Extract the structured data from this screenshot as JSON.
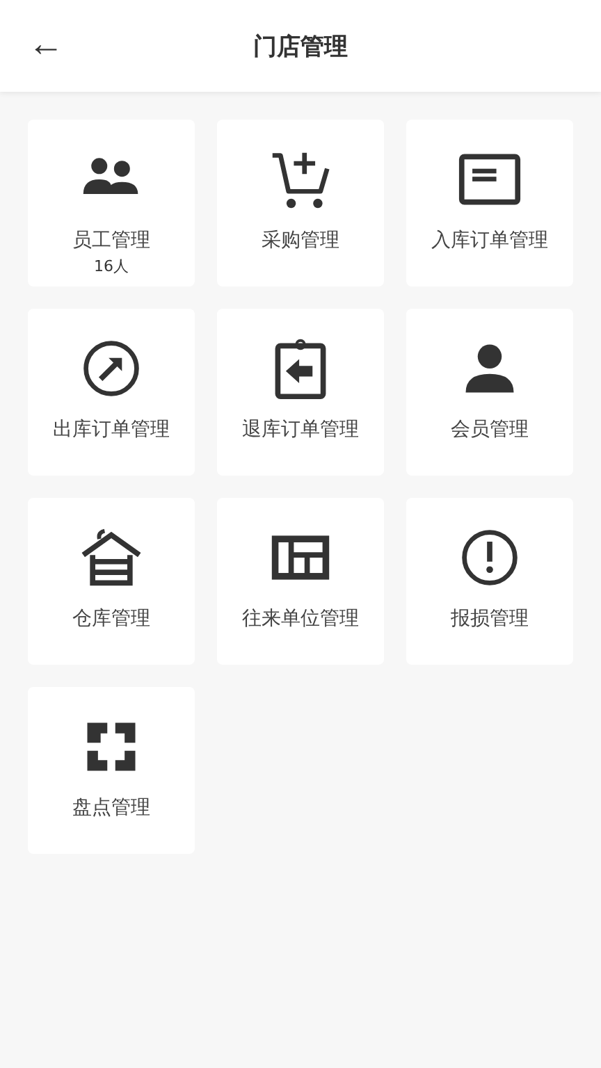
{
  "header": {
    "back": "←",
    "title": "门店管理"
  },
  "items": [
    {
      "label": "员工管理",
      "count": "16人"
    },
    {
      "label": "采购管理"
    },
    {
      "label": "入库订单管理"
    },
    {
      "label": "出库订单管理"
    },
    {
      "label": "退库订单管理"
    },
    {
      "label": "会员管理"
    },
    {
      "label": "仓库管理"
    },
    {
      "label": "往来单位管理"
    },
    {
      "label": "报损管理"
    },
    {
      "label": "盘点管理"
    }
  ]
}
